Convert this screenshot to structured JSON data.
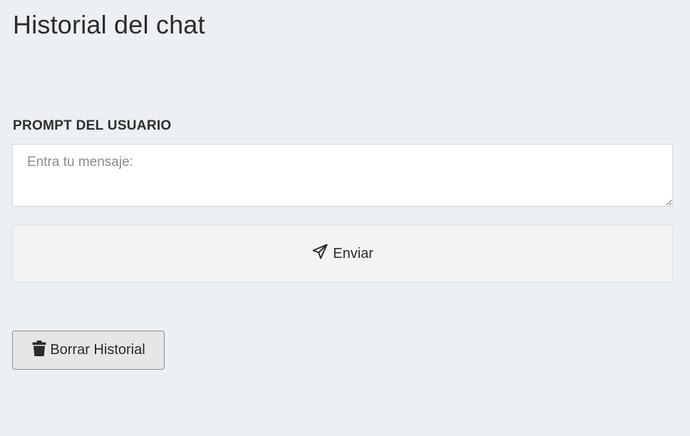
{
  "header": {
    "title": "Historial del chat"
  },
  "prompt": {
    "label": "PROMPT DEL USUARIO",
    "placeholder": "Entra tu mensaje:",
    "value": ""
  },
  "actions": {
    "send_label": "Enviar",
    "send_icon": "paper-plane-icon",
    "clear_label": "Borrar Historial",
    "clear_icon": "trash-icon"
  },
  "colors": {
    "background": "#eceff4",
    "input_background": "#ffffff",
    "send_button_background": "#f3f3f3",
    "clear_button_background": "#e6e6e6",
    "text": "#2b2b2b"
  }
}
